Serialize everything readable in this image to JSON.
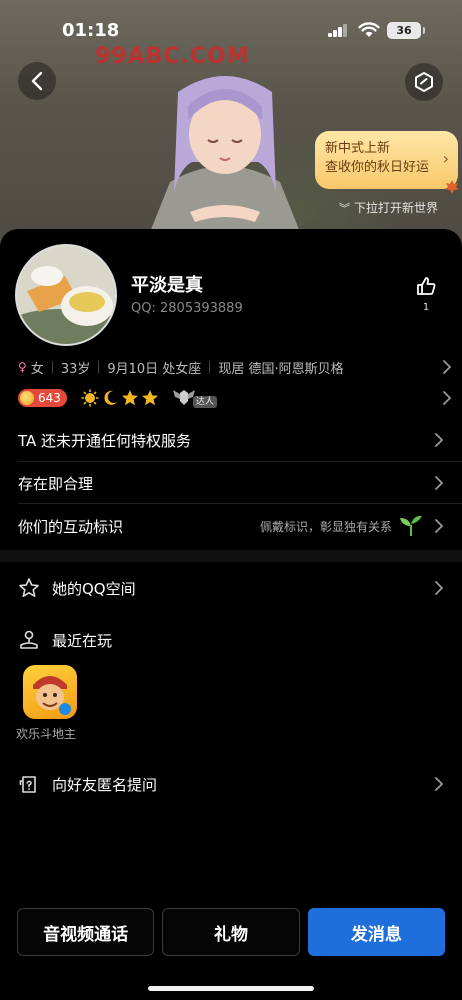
{
  "status_bar": {
    "time": "01:18",
    "battery": "36"
  },
  "hero": {
    "watermark": "99ABC.COM",
    "promo_line1": "新中式上新",
    "promo_line2": "查收你的秋日好运",
    "pull_hint": "下拉打开新世界"
  },
  "profile": {
    "nickname": "平淡是真",
    "qq_label": "QQ:",
    "qq_number": "2805393889",
    "like_count": "1"
  },
  "info": {
    "gender": "女",
    "age": "33岁",
    "birthday": "9月10日 处女座",
    "residence": "现居 德国·阿恩斯贝格"
  },
  "level": {
    "value": "643",
    "daren_tag": "达人"
  },
  "rows": {
    "privilege": "TA 还未开通任何特权服务",
    "signature": "存在即合理",
    "interaction": "你们的互动标识",
    "interaction_hint": "佩戴标识，彰显独有关系"
  },
  "sections": {
    "qzone": "她的QQ空间",
    "recent_play": "最近在玩",
    "game_name": "欢乐斗地主",
    "anon_question": "向好友匿名提问"
  },
  "actions": {
    "call": "音视频通话",
    "gift": "礼物",
    "message": "发消息"
  },
  "colors": {
    "primary": "#1e6fdc",
    "level_badge": "#e24b3b",
    "promo_bg": "#f8c86a"
  }
}
